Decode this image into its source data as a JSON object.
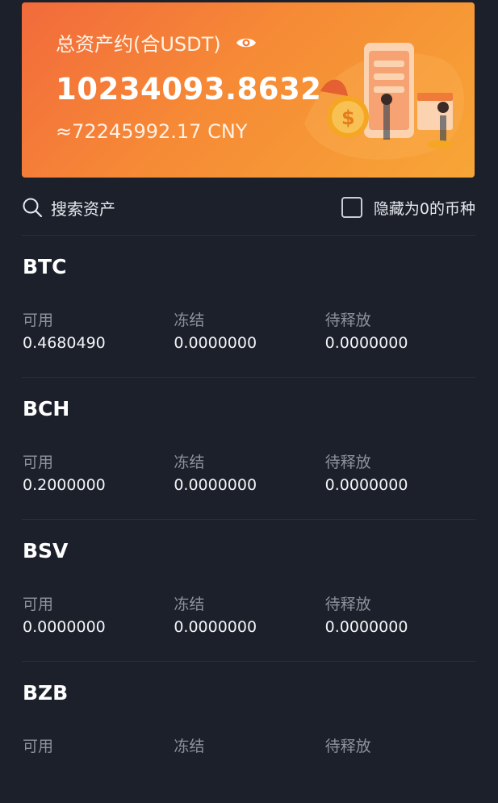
{
  "banner": {
    "title": "总资产约(合USDT)",
    "total": "10234093.8632",
    "cny": "≈72245992.17 CNY"
  },
  "toolbar": {
    "search_label": "搜索资产",
    "hide_zero_label": "隐藏为0的币种"
  },
  "assets": [
    {
      "name": "BTC",
      "available_label": "可用",
      "available": "0.4680490",
      "frozen_label": "冻结",
      "frozen": "0.0000000",
      "pending_label": "待释放",
      "pending": "0.0000000"
    },
    {
      "name": "BCH",
      "available_label": "可用",
      "available": "0.2000000",
      "frozen_label": "冻结",
      "frozen": "0.0000000",
      "pending_label": "待释放",
      "pending": "0.0000000"
    },
    {
      "name": "BSV",
      "available_label": "可用",
      "available": "0.0000000",
      "frozen_label": "冻结",
      "frozen": "0.0000000",
      "pending_label": "待释放",
      "pending": "0.0000000"
    },
    {
      "name": "BZB",
      "available_label": "可用",
      "frozen_label": "冻结",
      "pending_label": "待释放"
    }
  ],
  "colors": {
    "background": "#1b202b",
    "banner_start": "#f26a3c",
    "banner_end": "#f7a636",
    "muted_text": "#8d929c"
  }
}
